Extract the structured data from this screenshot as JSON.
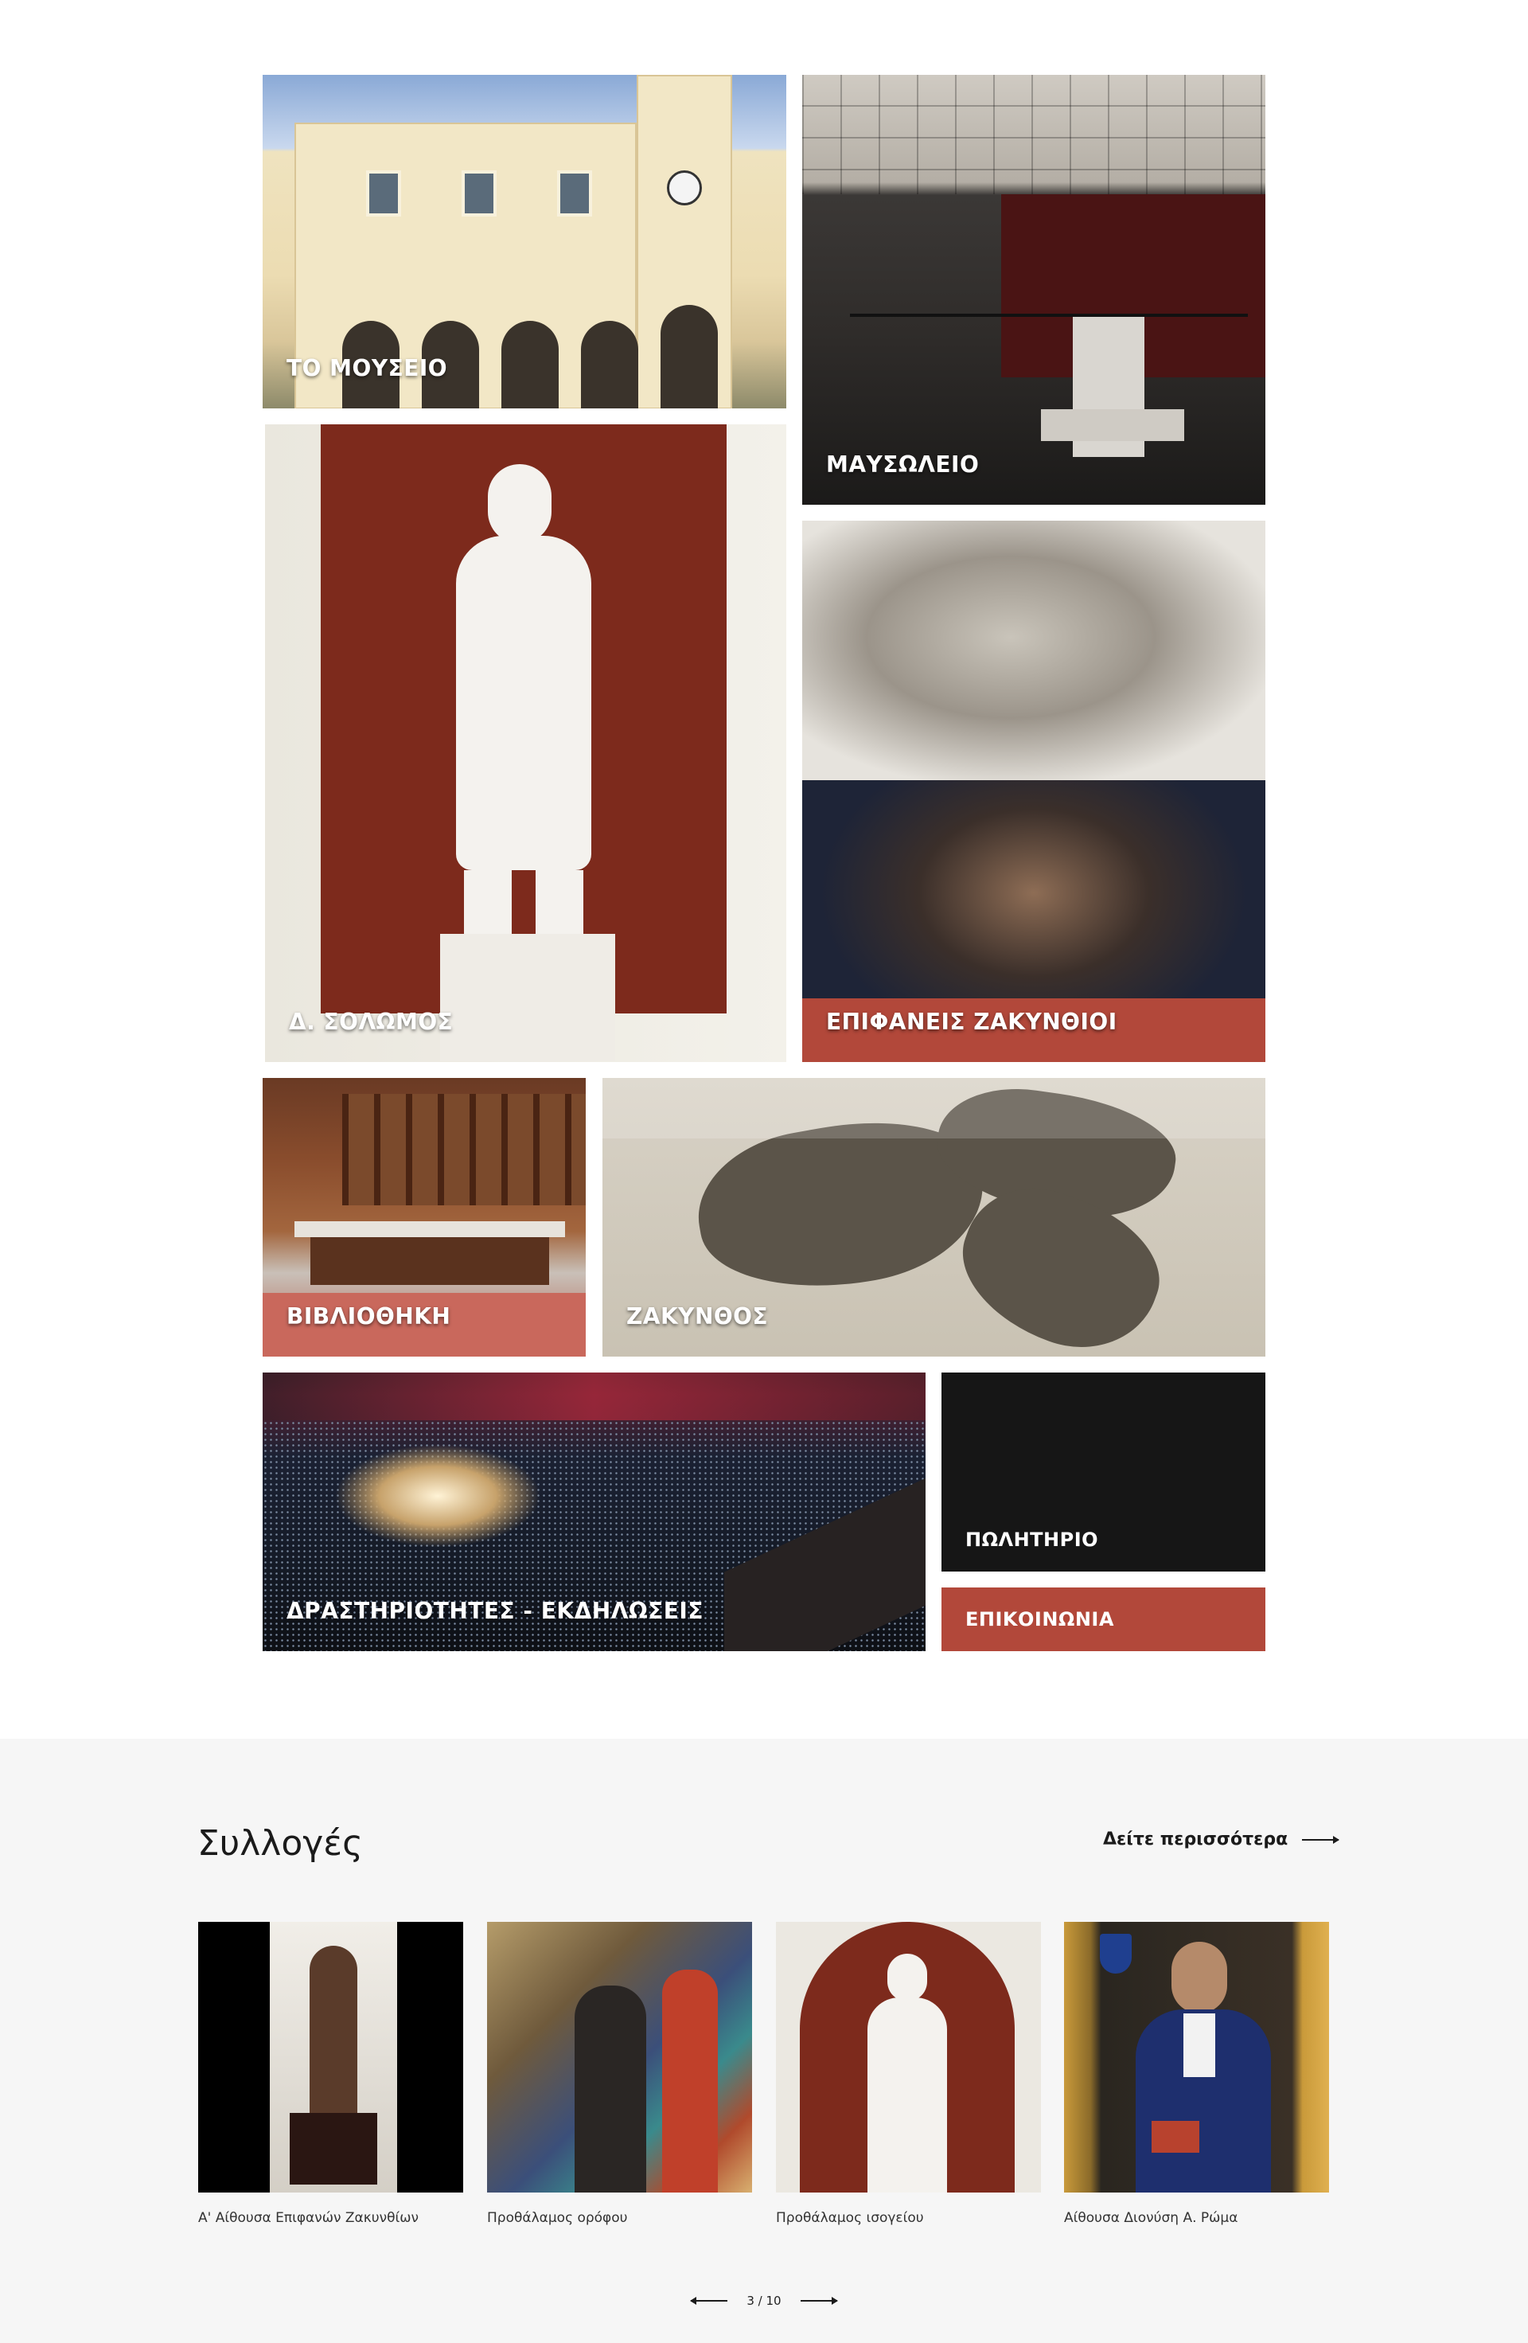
{
  "tiles": {
    "museum": "ΤΟ ΜΟΥΣΕΙΟ",
    "mausoleum": "ΜΑΥΣΩΛΕΙΟ",
    "solomos": "Δ. ΣΟΛΩΜΟΣ",
    "notable_people": "ΕΠΙΦΑΝΕΙΣ ΖΑΚΥΝΘΙΟΙ",
    "library": "ΒΙΒΛΙΟΘΗΚΗ",
    "zakynthos": "ΖΑΚΥΝΘΟΣ",
    "events": "ΔΡΑΣΤΗΡΙΟΤΗΤΕΣ - ΕΚΔΗΛΩΣΕΙΣ",
    "shop": "ΠΩΛΗΤΗΡΙΟ",
    "contact": "ΕΠΙΚΟΙΝΩΝΙΑ"
  },
  "collections": {
    "title": "Συλλογές",
    "see_more": "Δείτε περισσότερα",
    "items": [
      {
        "caption": "Α' Αίθουσα Επιφανών Ζακυνθίων"
      },
      {
        "caption": "Προθάλαμος ορόφου"
      },
      {
        "caption": "Προθάλαμος ισογείου"
      },
      {
        "caption": "Αίθουσα Διονύση Α. Ρώμα"
      }
    ],
    "pager": "3 / 10"
  },
  "colors": {
    "accent_red": "#b2483a",
    "dark": "#161616",
    "section_bg": "#f6f6f6"
  },
  "icons": [
    "arrow-right-icon",
    "arrow-left-icon"
  ]
}
